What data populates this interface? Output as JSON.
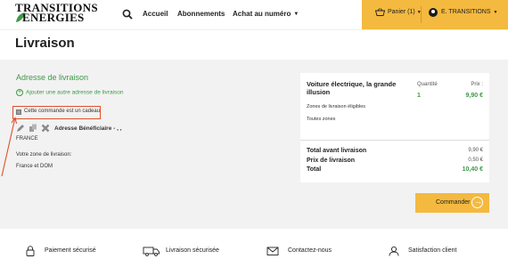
{
  "header": {
    "logo": {
      "line1": "TRANSITIONS",
      "line2": "ENERGIES"
    },
    "nav": [
      {
        "label": "Accueil"
      },
      {
        "label": "Abonnements"
      },
      {
        "label": "Achat au numéro"
      }
    ],
    "cart_label": "Panier (1)",
    "account_label": "E. TRANSITIONS"
  },
  "page": {
    "title": "Livraison"
  },
  "address": {
    "title": "Adresse de livraison",
    "add_link": "Ajouter une autre adresse de livraison",
    "gift_label": "Cette commande est un cadeau",
    "name": "Adresse Bénéficiaire - , ,",
    "country": "FRANCE",
    "zone_label": "Votre zone de livraison:",
    "zone_value": "France et DOM"
  },
  "summary": {
    "product": "Voiture électrique, la grande illusion",
    "qty_head": "Quantité",
    "price_head": "Prix :",
    "qty": "1",
    "price": "9,90 €",
    "zones_label": "Zones de livraison éligibles",
    "zones_value": "Toutes zones",
    "totals": [
      {
        "label": "Total avant livraison",
        "value": "9,90 €"
      },
      {
        "label": "Prix de livraison",
        "value": "0,50 €"
      },
      {
        "label": "Total",
        "value": "10,40 €"
      }
    ]
  },
  "order_button": "Commander",
  "features": [
    {
      "label": "Paiement sécurisé",
      "icon": "lock-icon"
    },
    {
      "label": "Livraison sécurisée",
      "icon": "truck-icon"
    },
    {
      "label": "Contactez-nous",
      "icon": "mail-icon"
    },
    {
      "label": "Satisfaction client",
      "icon": "user-icon"
    }
  ],
  "colors": {
    "accent": "#f4b93f",
    "green": "#3d9a46",
    "highlight": "#e0502a"
  }
}
